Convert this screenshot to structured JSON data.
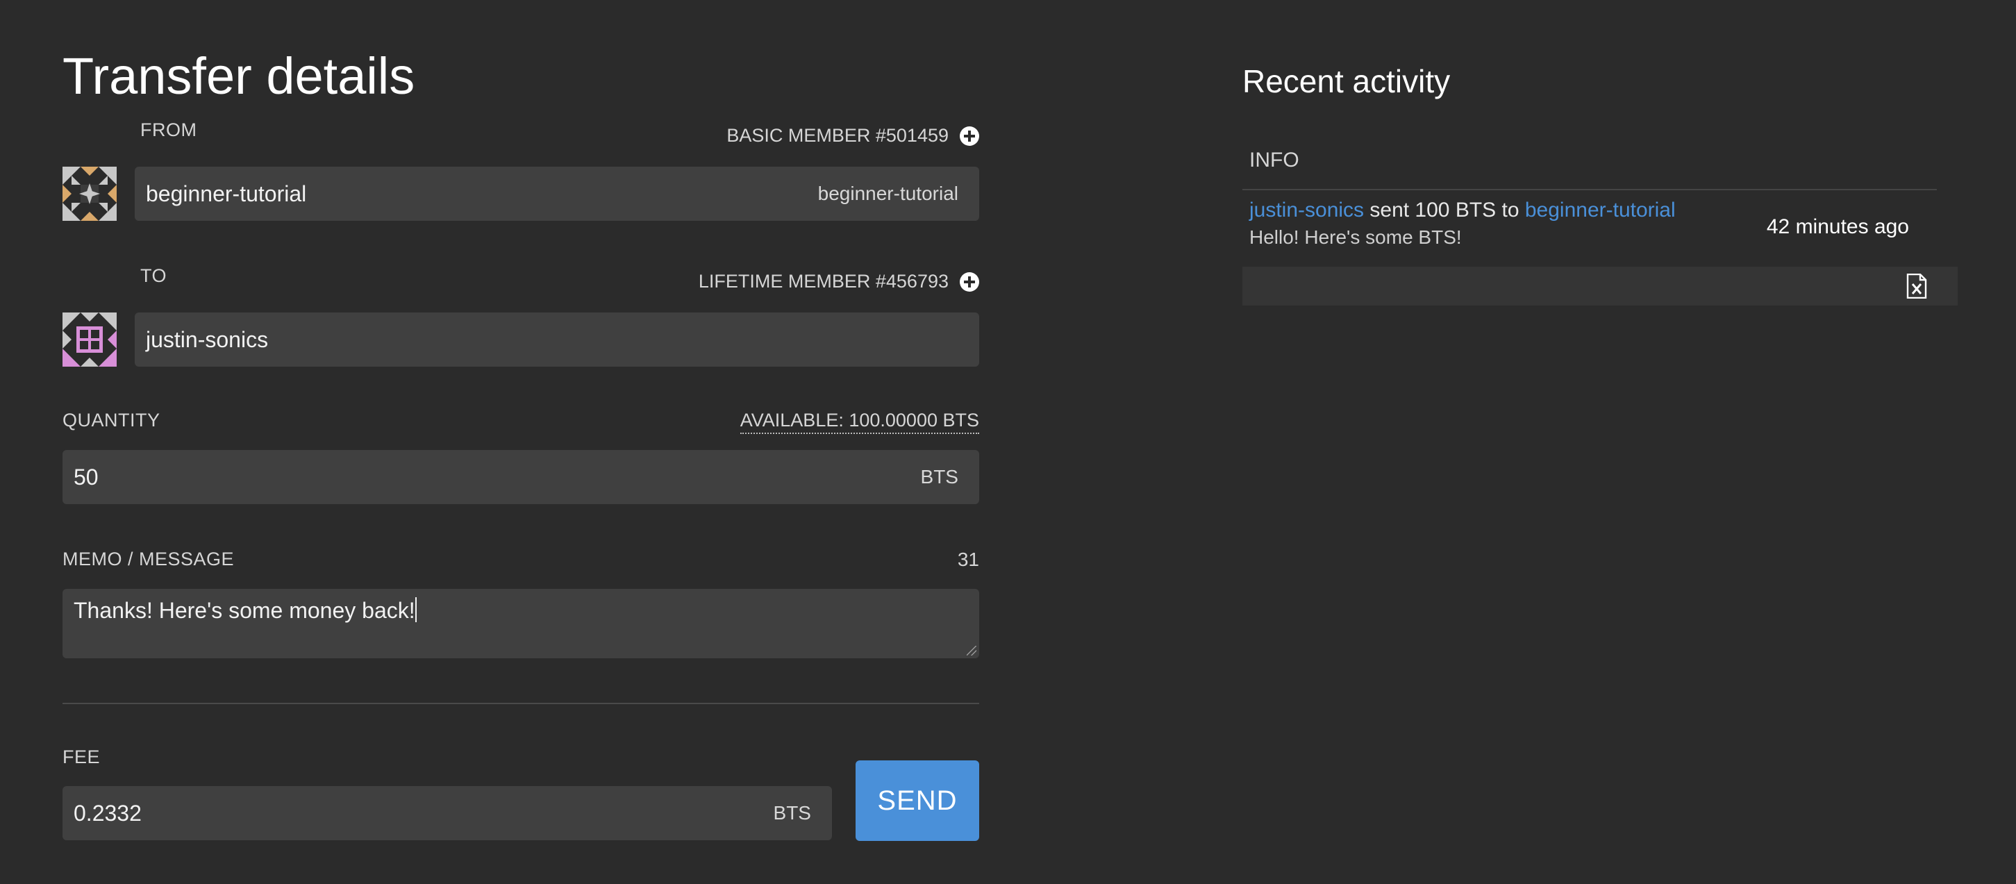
{
  "transfer": {
    "title": "Transfer details",
    "from": {
      "label": "FROM",
      "member": "BASIC MEMBER #501459",
      "account": "beginner-tutorial",
      "account_suffix": "beginner-tutorial"
    },
    "to": {
      "label": "TO",
      "member": "LIFETIME MEMBER #456793",
      "account": "justin-sonics"
    },
    "quantity": {
      "label": "QUANTITY",
      "available": "AVAILABLE: 100.00000 BTS",
      "value": "50",
      "asset": "BTS"
    },
    "memo": {
      "label": "MEMO / MESSAGE",
      "count": "31",
      "value": "Thanks! Here's some money back!"
    },
    "fee": {
      "label": "FEE",
      "value": "0.2332",
      "asset": "BTS"
    },
    "send_label": "SEND"
  },
  "activity": {
    "title": "Recent activity",
    "column_header": "INFO",
    "items": [
      {
        "sender": "justin-sonics",
        "action": " sent 100 BTS to ",
        "recipient": "beginner-tutorial",
        "memo": "Hello! Here's some BTS!",
        "time": "42 minutes ago"
      }
    ],
    "export_icon": "excel-file-icon"
  },
  "colors": {
    "background": "#2b2b2b",
    "field": "#404040",
    "accent": "#4a90d9"
  }
}
